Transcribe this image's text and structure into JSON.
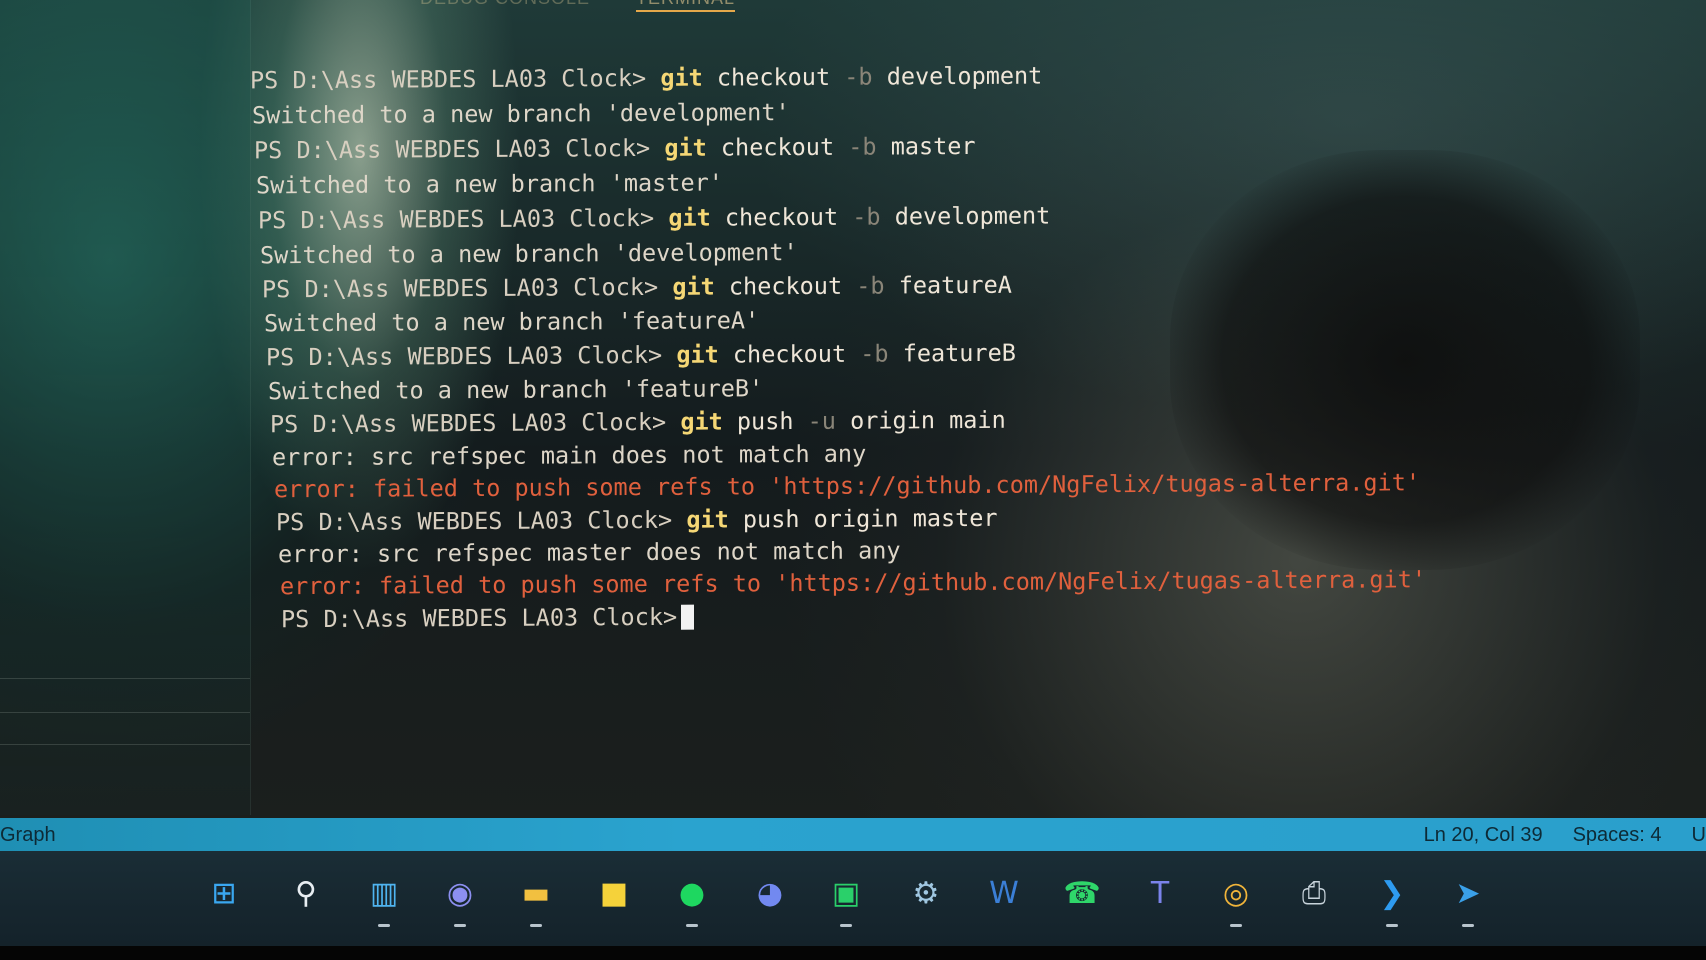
{
  "panel_tabs": [
    "DEBUG CONSOLE",
    "TERMINAL"
  ],
  "terminal": {
    "lines": [
      {
        "type": "cmd",
        "prompt": "PS D:\\Ass WEBDES LA03 Clock>",
        "cmd": "git",
        "rest1": " checkout ",
        "flag": "-b",
        "rest2": " development"
      },
      {
        "type": "out",
        "text": "Switched to a new branch 'development'"
      },
      {
        "type": "cmd",
        "prompt": "PS D:\\Ass WEBDES LA03 Clock>",
        "cmd": "git",
        "rest1": " checkout ",
        "flag": "-b",
        "rest2": " master"
      },
      {
        "type": "out",
        "text": "Switched to a new branch 'master'"
      },
      {
        "type": "cmd",
        "prompt": "PS D:\\Ass WEBDES LA03 Clock>",
        "cmd": "git",
        "rest1": " checkout ",
        "flag": "-b",
        "rest2": " development"
      },
      {
        "type": "out",
        "text": "Switched to a new branch 'development'"
      },
      {
        "type": "cmd",
        "prompt": "PS D:\\Ass WEBDES LA03 Clock>",
        "cmd": "git",
        "rest1": " checkout ",
        "flag": "-b",
        "rest2": " featureA"
      },
      {
        "type": "out",
        "text": "Switched to a new branch 'featureA'"
      },
      {
        "type": "cmd",
        "prompt": "PS D:\\Ass WEBDES LA03 Clock>",
        "cmd": "git",
        "rest1": " checkout ",
        "flag": "-b",
        "rest2": " featureB"
      },
      {
        "type": "out",
        "text": "Switched to a new branch 'featureB'"
      },
      {
        "type": "cmd",
        "prompt": "PS D:\\Ass WEBDES LA03 Clock>",
        "cmd": "git",
        "rest1": " push ",
        "flag": "-u",
        "rest2": " origin main"
      },
      {
        "type": "out",
        "text": "error: src refspec main does not match any"
      },
      {
        "type": "err",
        "text": "error: failed to push some refs to 'https://github.com/NgFelix/tugas-alterra.git'"
      },
      {
        "type": "cmd",
        "prompt": "PS D:\\Ass WEBDES LA03 Clock>",
        "cmd": "git",
        "rest1": " push origin master",
        "flag": "",
        "rest2": ""
      },
      {
        "type": "out",
        "text": "error: src refspec master does not match any"
      },
      {
        "type": "err",
        "text": "error: failed to push some refs to 'https://github.com/NgFelix/tugas-alterra.git'"
      },
      {
        "type": "prompt",
        "prompt": "PS D:\\Ass WEBDES LA03 Clock>"
      }
    ]
  },
  "statusbar": {
    "left": "Graph",
    "position": "Ln 20, Col 39",
    "spaces": "Spaces: 4",
    "encoding": "U",
    "color": "#2aa3cf"
  },
  "taskbar": {
    "icons": [
      {
        "name": "start-icon",
        "glyph": "⊞",
        "color": "#3aa7f0"
      },
      {
        "name": "search-icon",
        "glyph": "⚲",
        "color": "#e8eef2"
      },
      {
        "name": "widgets-icon",
        "glyph": "▥",
        "color": "#4fb4f0"
      },
      {
        "name": "chat-icon",
        "glyph": "◉",
        "color": "#8c8ff0"
      },
      {
        "name": "file-explorer-icon",
        "glyph": "▬",
        "color": "#f2c040"
      },
      {
        "name": "sticky-notes-icon",
        "glyph": "■",
        "color": "#f5d23a"
      },
      {
        "name": "spotify-icon",
        "glyph": "●",
        "color": "#1ed760"
      },
      {
        "name": "discord-icon",
        "glyph": "◕",
        "color": "#7289f0"
      },
      {
        "name": "line-icon",
        "glyph": "▣",
        "color": "#2ad06a"
      },
      {
        "name": "steam-icon",
        "glyph": "⚙",
        "color": "#9fc6e0"
      },
      {
        "name": "word-icon",
        "glyph": "W",
        "color": "#3b7fd6"
      },
      {
        "name": "whatsapp-icon",
        "glyph": "☎",
        "color": "#2fd66a"
      },
      {
        "name": "teams-icon",
        "glyph": "T",
        "color": "#7b83eb"
      },
      {
        "name": "chrome-icon",
        "glyph": "◎",
        "color": "#f0b43a"
      },
      {
        "name": "printer-icon",
        "glyph": "⎙",
        "color": "#c8d4dc"
      },
      {
        "name": "vscode-icon",
        "glyph": "❯",
        "color": "#2e9bf0"
      },
      {
        "name": "telegram-icon",
        "glyph": "➤",
        "color": "#3aa0e8"
      }
    ]
  }
}
